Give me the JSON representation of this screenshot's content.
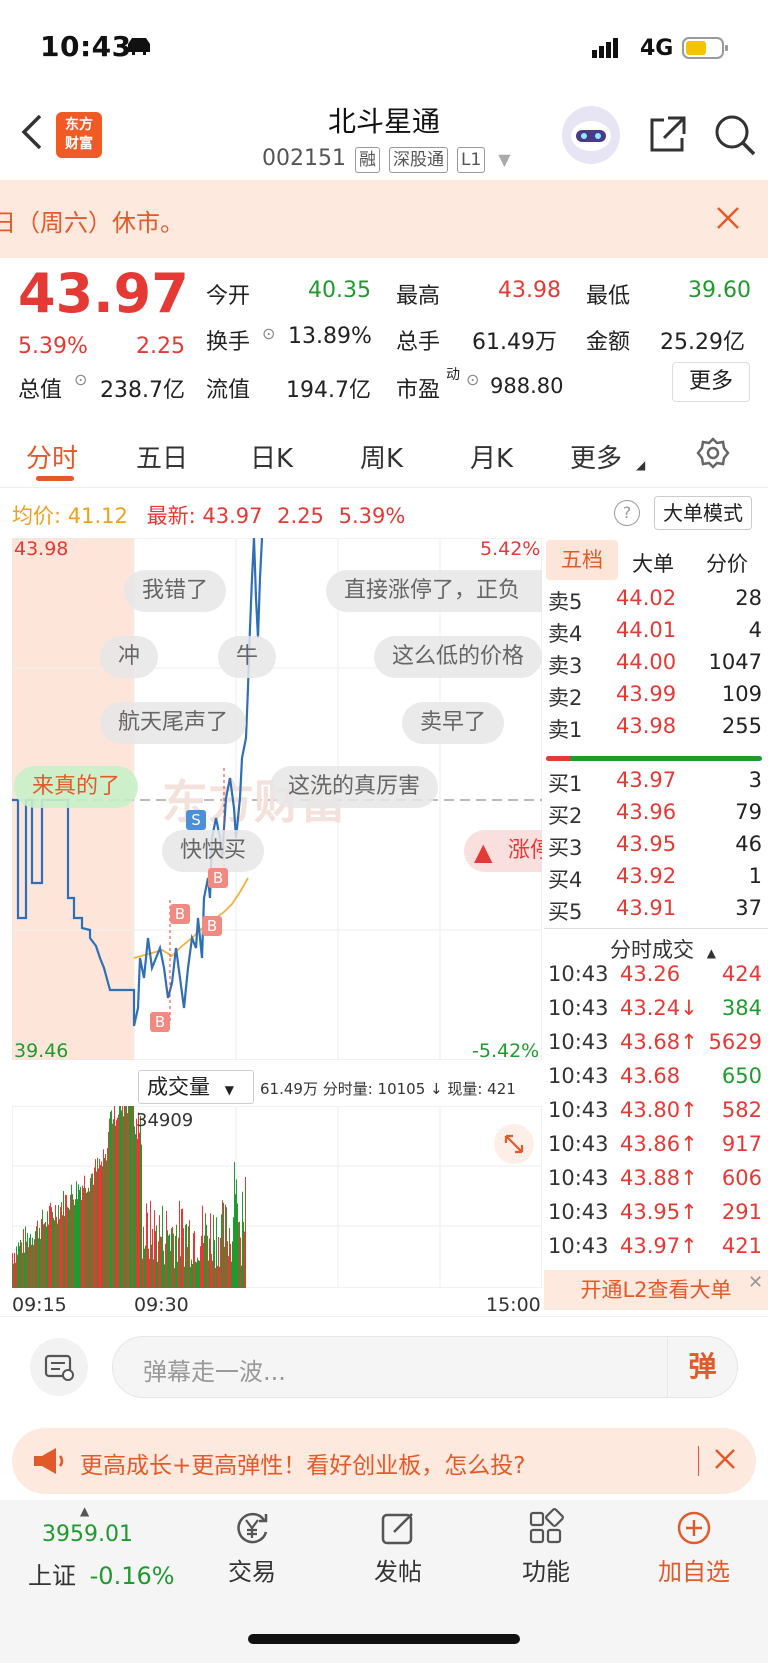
{
  "status_bar": {
    "time": "10:43",
    "network": "4G"
  },
  "header": {
    "title": "北斗星通",
    "code": "002151",
    "tags": [
      "融",
      "深股通",
      "L1"
    ],
    "logo_text": "东方财富"
  },
  "notice": {
    "text": "日（周六）休市。"
  },
  "quote": {
    "price": "43.97",
    "change_pct": "5.39%",
    "change": "2.25",
    "open_label": "今开",
    "open": "40.35",
    "high_label": "最高",
    "high": "43.98",
    "low_label": "最低",
    "low": "39.60",
    "turnover_label": "换手",
    "turnover": "13.89%",
    "total_vol_label": "总手",
    "total_vol": "61.49万",
    "amount_label": "金额",
    "amount": "25.29亿",
    "mktcap_label": "总值",
    "mktcap": "238.7亿",
    "float_label": "流值",
    "float": "194.7亿",
    "pe_label": "市盈",
    "pe_sup": "动",
    "pe": "988.80",
    "more_button": "更多"
  },
  "tabs": [
    "分时",
    "五日",
    "日K",
    "周K",
    "月K",
    "更多"
  ],
  "chart_info": {
    "avg_label": "均价:",
    "avg": "41.12",
    "latest_label": "最新:",
    "latest": "43.97",
    "latest_change": "2.25",
    "latest_pct": "5.39%",
    "mode_button": "大单模式"
  },
  "chart_data": {
    "type": "line",
    "ymax_label": "43.98",
    "ymin_label": "39.46",
    "pct_top": "5.42%",
    "pct_bottom": "-5.42%",
    "ylim": [
      39.46,
      43.98
    ],
    "x_labels": [
      "09:15",
      "09:30",
      "15:00"
    ],
    "vol_peak_label": "34909",
    "vol_selector": "成交量",
    "vol_info": "61.49万 分时量: 10105 ↓ 现量: 421",
    "markers": [
      "S",
      "B",
      "B",
      "B",
      "B",
      "B"
    ]
  },
  "danmaku": [
    "我错了",
    "直接涨停了，正负",
    "冲",
    "牛",
    "这么低的价格",
    "航天尾声了",
    "卖早了",
    "来真的了",
    "这洗的真厉害",
    "快快买",
    "涨停"
  ],
  "orderbook": {
    "tabs": [
      "五档",
      "大单",
      "分价"
    ],
    "asks": [
      {
        "label": "卖5",
        "price": "44.02",
        "vol": "28"
      },
      {
        "label": "卖4",
        "price": "44.01",
        "vol": "4"
      },
      {
        "label": "卖3",
        "price": "44.00",
        "vol": "1047"
      },
      {
        "label": "卖2",
        "price": "43.99",
        "vol": "109"
      },
      {
        "label": "卖1",
        "price": "43.98",
        "vol": "255"
      }
    ],
    "bids": [
      {
        "label": "买1",
        "price": "43.97",
        "vol": "3"
      },
      {
        "label": "买2",
        "price": "43.96",
        "vol": "79"
      },
      {
        "label": "买3",
        "price": "43.95",
        "vol": "46"
      },
      {
        "label": "买4",
        "price": "43.92",
        "vol": "1"
      },
      {
        "label": "买5",
        "price": "43.91",
        "vol": "37"
      }
    ]
  },
  "trades": {
    "title": "分时成交",
    "rows": [
      {
        "time": "10:43",
        "price": "43.26",
        "dir": "",
        "vol": "424"
      },
      {
        "time": "10:43",
        "price": "43.24↓",
        "dir": "down",
        "vol": "384"
      },
      {
        "time": "10:43",
        "price": "43.68↑",
        "dir": "up",
        "vol": "5629"
      },
      {
        "time": "10:43",
        "price": "43.68",
        "dir": "",
        "vol": "650"
      },
      {
        "time": "10:43",
        "price": "43.80↑",
        "dir": "up",
        "vol": "582"
      },
      {
        "time": "10:43",
        "price": "43.86↑",
        "dir": "up",
        "vol": "917"
      },
      {
        "time": "10:43",
        "price": "43.88↑",
        "dir": "up",
        "vol": "606"
      },
      {
        "time": "10:43",
        "price": "43.95↑",
        "dir": "up",
        "vol": "291"
      },
      {
        "time": "10:43",
        "price": "43.97↑",
        "dir": "up",
        "vol": "421"
      }
    ],
    "l2_button": "开通L2查看大单"
  },
  "comment": {
    "placeholder": "弹幕走一波...",
    "danmu_button": "弹"
  },
  "ad": {
    "text": "更高成长+更高弹性！看好创业板，怎么投?"
  },
  "bottom_nav": {
    "index_value": "3959.01",
    "index_name": "上证",
    "index_change": "-0.16%",
    "trade": "交易",
    "post": "发帖",
    "func": "功能",
    "add": "加自选"
  }
}
